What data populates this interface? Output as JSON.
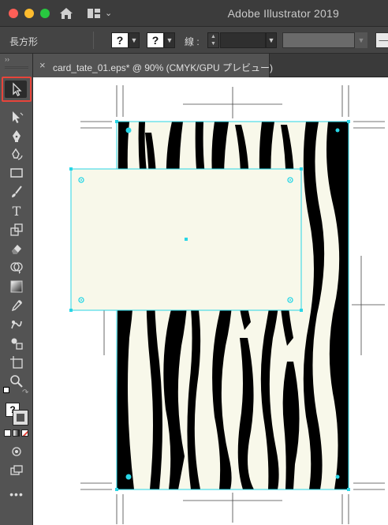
{
  "app": {
    "title": "Adobe Illustrator 2019"
  },
  "control_bar": {
    "object_type_label": "長方形",
    "fill_swatch_symbol": "?",
    "stroke_swatch_symbol": "?",
    "stroke_label": "線 :"
  },
  "document_tab": {
    "close_symbol": "×",
    "title": "card_tate_01.eps* @ 90% (CMYK/GPU プレビュー)"
  },
  "toolbar": {
    "collapse_symbol": "››",
    "active_tool": "selection-tool",
    "tools": [
      "selection-tool",
      "direct-selection-tool",
      "pen-tool",
      "curvature-tool",
      "rectangle-tool",
      "paintbrush-tool",
      "type-tool",
      "free-transform-tool",
      "eraser-tool",
      "shape-builder-tool",
      "gradient-tool",
      "eyedropper-tool",
      "puppet-warp-tool",
      "blend-tool",
      "artboard-tool",
      "zoom-tool"
    ],
    "type_tool_glyph": "T",
    "default_colors_symbol": "?",
    "more_tools_symbol": "•••"
  },
  "colors": {
    "accent_selection": "#29d6e6",
    "highlight_red": "#e8443a",
    "zebra_black": "#000000",
    "zebra_cream": "#f8f8ea",
    "panel_bg": "#535353"
  }
}
